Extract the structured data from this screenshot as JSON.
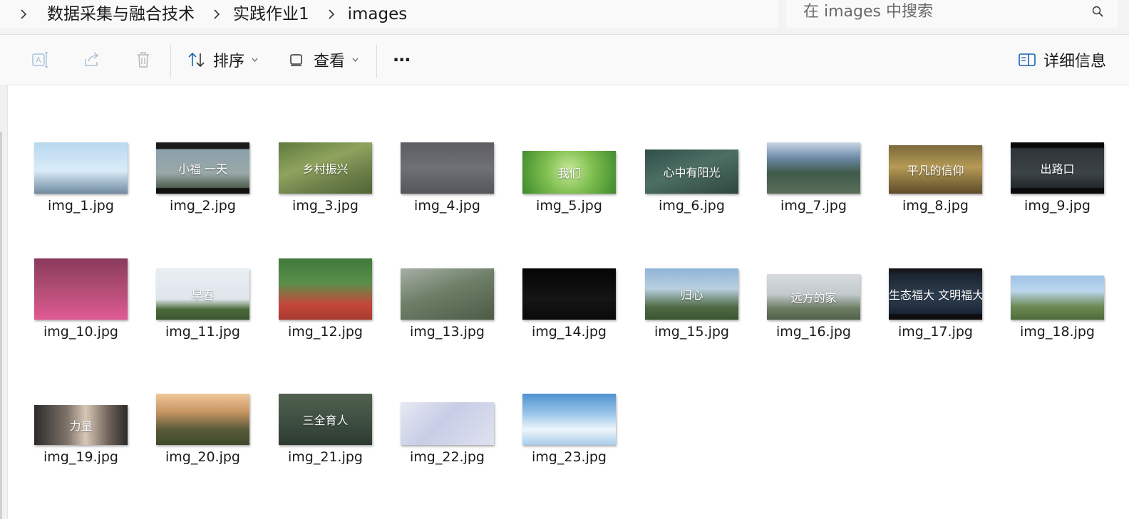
{
  "breadcrumb": {
    "items": [
      "数据采集与融合技术",
      "实践作业1",
      "images"
    ]
  },
  "search": {
    "placeholder": "在 images 中搜索"
  },
  "toolbar": {
    "sort_label": "排序",
    "view_label": "查看",
    "more_label": "···",
    "details_label": "详细信息"
  },
  "files": [
    {
      "name": "img_1.jpg",
      "bg": "linear-gradient(180deg,#b8d8ef 0%,#d9ecf8 55%,#6f8aa0 100%)",
      "caption": "",
      "height": 72
    },
    {
      "name": "img_2.jpg",
      "bg": "linear-gradient(180deg,#1b1b1b 0%,#1b1b1b 12%,#8aa0ad 14%,#9aa9a8 60%,#50604f 88%,#111 90%)",
      "caption": "小福 一天",
      "height": 72
    },
    {
      "name": "img_3.jpg",
      "bg": "linear-gradient(160deg,#5f7a3e 0%,#8fa35d 40%,#6c7f4a 70%,#4f6534 100%)",
      "caption": "乡村振兴",
      "height": 72
    },
    {
      "name": "img_4.jpg",
      "bg": "linear-gradient(180deg,#5c5d63 0%,#6f7076 50%,#55565b 100%)",
      "caption": "",
      "height": 72
    },
    {
      "name": "img_5.jpg",
      "bg": "radial-gradient(circle at 50% 45%,#c8e89a 0%,#7fbf4f 45%,#3f8a2d 100%)",
      "caption": "我们",
      "height": 60
    },
    {
      "name": "img_6.jpg",
      "bg": "linear-gradient(160deg,#2f4f4a 0%,#4d6f63 45%,#2e473f 100%)",
      "caption": "心中有阳光",
      "height": 62
    },
    {
      "name": "img_7.jpg",
      "bg": "linear-gradient(180deg,#c9d6e4 0%,#6d8aa8 30%,#3f5a49 60%,#5b6e5a 100%)",
      "caption": "",
      "height": 72
    },
    {
      "name": "img_8.jpg",
      "bg": "linear-gradient(180deg,#7c6a3c 0%,#b59a55 45%,#5d4b2a 100%)",
      "caption": "平凡的信仰",
      "height": 68
    },
    {
      "name": "img_9.jpg",
      "bg": "linear-gradient(180deg,#0a0a0a 0%,#0a0a0a 10%,#2e3437 12%,#3c4346 60%,#24292b 88%,#0a0a0a 90%)",
      "caption": "出路口",
      "height": 72
    },
    {
      "name": "img_10.jpg",
      "bg": "linear-gradient(180deg,#8a3a5d 0%,#b24d74 50%,#e05a94 100%)",
      "caption": "",
      "height": 86
    },
    {
      "name": "img_11.jpg",
      "bg": "linear-gradient(180deg,#e9eef3 0%,#dfe6ec 60%,#4b6a3a 80%,#3a5630 100%)",
      "caption": "早春",
      "height": 72
    },
    {
      "name": "img_12.jpg",
      "bg": "linear-gradient(180deg,#3f7a3b 0%,#5a8f4a 40%,#c5473a 75%,#a83a2f 100%)",
      "caption": "",
      "height": 86
    },
    {
      "name": "img_13.jpg",
      "bg": "linear-gradient(160deg,#a6b0a6 0%,#6e7e67 45%,#4d5b46 100%)",
      "caption": "",
      "height": 72
    },
    {
      "name": "img_14.jpg",
      "bg": "linear-gradient(180deg,#050505 0%,#151515 60%,#0a0a0a 100%)",
      "caption": "",
      "height": 72
    },
    {
      "name": "img_15.jpg",
      "bg": "linear-gradient(180deg,#8fb5d8 0%,#b9cfe0 40%,#4f6b44 75%,#3a5632 100%)",
      "caption": "归心",
      "height": 72
    },
    {
      "name": "img_16.jpg",
      "bg": "linear-gradient(180deg,#d7dbde 0%,#c2c9cc 45%,#6b7d63 75%,#51604b 100%)",
      "caption": "远方的家",
      "height": 64
    },
    {
      "name": "img_17.jpg",
      "bg": "linear-gradient(180deg,#111 0%,#1c2530 12%,#2f3f52 55%,#1a2533 88%,#0d0d0d 90%)",
      "caption": "生态福大 文明福大",
      "height": 72
    },
    {
      "name": "img_18.jpg",
      "bg": "linear-gradient(180deg,#9fc3e6 0%,#bcd6ee 35%,#6d8a55 70%,#4e6b3c 100%)",
      "caption": "",
      "height": 62
    },
    {
      "name": "img_19.jpg",
      "bg": "linear-gradient(90deg,#2b2b2b 0%,#7d7269 35%,#d7c7b6 55%,#6d625a 80%,#2a2a2a 100%)",
      "caption": "力量",
      "height": 56
    },
    {
      "name": "img_20.jpg",
      "bg": "linear-gradient(180deg,#f0c89a 0%,#c99663 35%,#5a5a3a 70%,#3d4a2a 100%)",
      "caption": "",
      "height": 72
    },
    {
      "name": "img_21.jpg",
      "bg": "linear-gradient(180deg,#51614e 0%,#3f5043 50%,#2d3a30 100%)",
      "caption": "三全育人",
      "height": 72
    },
    {
      "name": "img_22.jpg",
      "bg": "linear-gradient(135deg,#e6e8f3 0%,#c8cde6 45%,#dfe2f0 100%)",
      "caption": "",
      "height": 60
    },
    {
      "name": "img_23.jpg",
      "bg": "linear-gradient(180deg,#4f93d1 0%,#9cc7ea 40%,#eef5fb 70%,#a9cdea 100%)",
      "caption": "",
      "height": 72
    }
  ]
}
